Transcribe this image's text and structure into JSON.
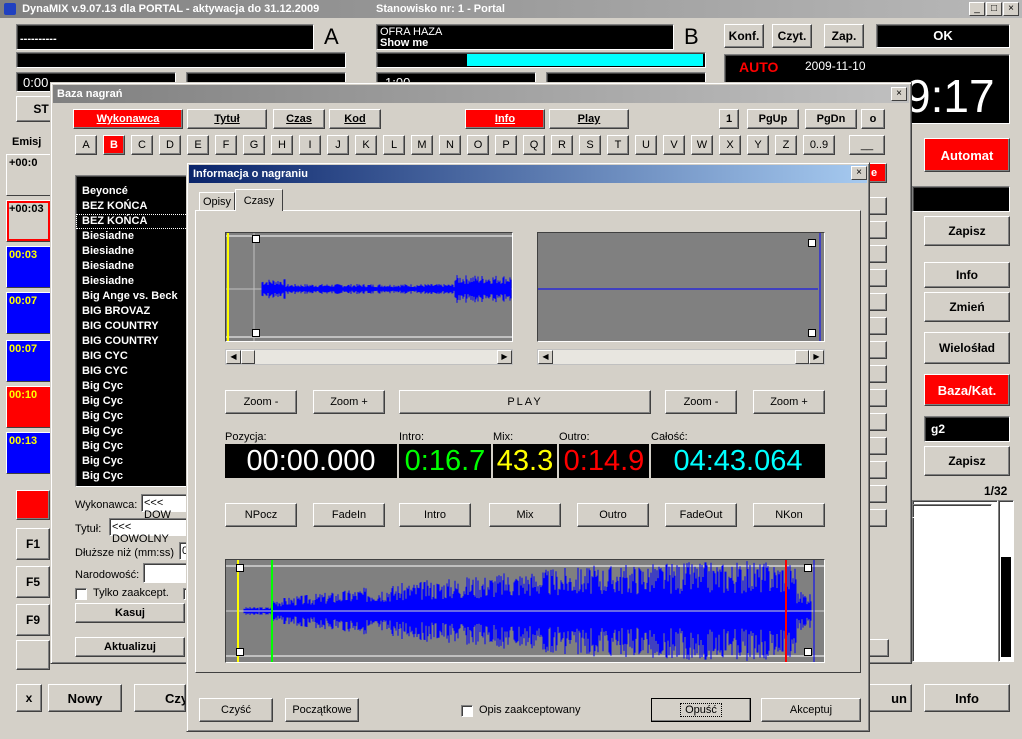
{
  "main": {
    "title": "DynaMIX v.9.07.13 dla PORTAL - aktywacja do 31.12.2009",
    "station": "Stanowisko nr: 1 - Portal",
    "player_a": {
      "letter": "A",
      "line1": "----------",
      "time_small": "0:00",
      "stop_label": "ST"
    },
    "player_b": {
      "letter": "B",
      "line1": "OFRA HAZA",
      "line2": "Show me",
      "time_small": "1:00"
    },
    "top_buttons": {
      "konf": "Konf.",
      "czyt": "Czyt.",
      "zap": "Zap.",
      "ok": "OK"
    },
    "status": {
      "mode": "AUTO",
      "date": "2009-11-10",
      "clock": "9:17"
    },
    "emisja_label": "Emisj",
    "slots": [
      {
        "time": "+00:0"
      },
      {
        "time": "+00:03"
      },
      {
        "time": "00:03"
      },
      {
        "time": "00:07"
      },
      {
        "time": "00:07"
      },
      {
        "time": "00:10"
      },
      {
        "time": "00:13"
      }
    ],
    "right_panel": {
      "automat": "Automat",
      "zapisz1": "Zapisz",
      "info": "Info",
      "zmien": "Zmień",
      "wieloslad": "Wielośład",
      "baza": "Baza/Kat.",
      "g2_value": "g2",
      "zapisz2": "Zapisz",
      "count": "1/32"
    },
    "fkeys": [
      "F1",
      "F5",
      "F9"
    ],
    "bottom": {
      "x": "x",
      "nowy": "Nowy",
      "czy": "Czy",
      "un": "un",
      "info": "Info"
    }
  },
  "baza": {
    "title": "Baza nagrań",
    "tabs": [
      "Wykonawca",
      "Tytuł",
      "Czas",
      "Kod",
      "Info",
      "Play"
    ],
    "nav": [
      "1",
      "PgUp",
      "PgDn",
      "o"
    ],
    "letters": [
      "A",
      "B",
      "C",
      "D",
      "E",
      "F",
      "G",
      "H",
      "I",
      "J",
      "K",
      "L",
      "M",
      "N",
      "O",
      "P",
      "Q",
      "R",
      "S",
      "T",
      "U",
      "V",
      "W",
      "X",
      "Y",
      "Z",
      "0..9",
      "__"
    ],
    "items": [
      "Beyoncé",
      "BEZ KOŃCA",
      "BEZ KOŃCA",
      "Biesiadne",
      "Biesiadne",
      "Biesiadne",
      "Biesiadne",
      "Big Ange vs. Beck",
      "BIG BROVAZ",
      "BIG COUNTRY",
      "BIG COUNTRY",
      "BIG CYC",
      "BIG CYC",
      "Big Cyc",
      "Big Cyc",
      "Big Cyc",
      "Big Cyc",
      "Big Cyc",
      "Big Cyc",
      "Big Cyc"
    ],
    "form": {
      "wykonawca_label": "Wykonawca:",
      "wykonawca_value": "<<< DOW",
      "tytul_label": "Tytuł:",
      "tytul_value": "<<< DOWOLNY",
      "dluzsze_label": "Dłuższe niż (mm:ss)",
      "dluzsze_value": "0",
      "narodowosc_label": "Narodowość:",
      "tylko_label": "Tylko zaakcept.",
      "kasuj": "Kasuj",
      "aktualizuj": "Aktualizuj"
    }
  },
  "info_dialog": {
    "title": "Informacja o nagraniu",
    "tabs": [
      "Opisy",
      "Czasy"
    ],
    "zoom_minus": "Zoom -",
    "zoom_plus": "Zoom +",
    "play": "PLAY",
    "labels": {
      "pozycja": "Pozycja:",
      "intro": "Intro:",
      "mix": "Mix:",
      "outro": "Outro:",
      "calosc": "Całość:"
    },
    "values": {
      "pozycja": "00:00.000",
      "intro": "0:16.7",
      "mix": "43.3",
      "outro": "0:14.9",
      "calosc": "04:43.064"
    },
    "colors": {
      "pozycja": "#ffffff",
      "intro": "#00ff00",
      "mix": "#ffff00",
      "outro": "#ff0000",
      "calosc": "#00ffff",
      "wave": "#0000ff"
    },
    "marker_buttons": [
      "NPocz",
      "FadeIn",
      "Intro",
      "Mix",
      "Outro",
      "FadeOut",
      "NKon"
    ],
    "footer": {
      "czysc": "Czyść",
      "poczatkowe": "Początkowe",
      "opis_label": "Opis zaakceptowany",
      "opusc": "Opuść",
      "akceptuj": "Akceptuj"
    }
  }
}
